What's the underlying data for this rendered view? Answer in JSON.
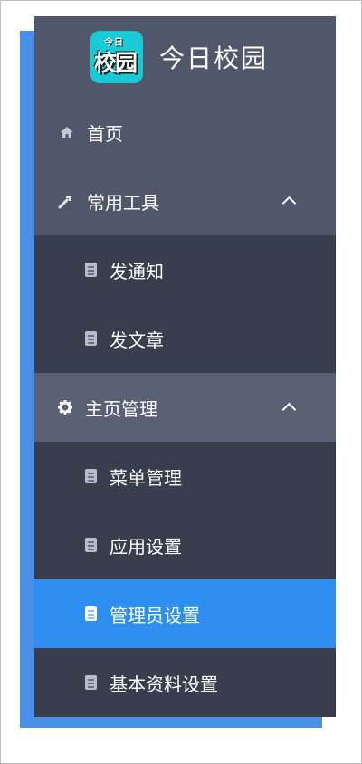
{
  "logo": {
    "badge_top": "今日",
    "badge_main": "校园",
    "title": "今日校园"
  },
  "nav": {
    "home": {
      "label": "首页",
      "icon": "home-icon"
    },
    "tools": {
      "label": "常用工具",
      "icon": "wrench-icon",
      "expanded": true,
      "items": [
        {
          "label": "发通知",
          "icon": "document-icon"
        },
        {
          "label": "发文章",
          "icon": "document-icon"
        }
      ]
    },
    "homepage_mgmt": {
      "label": "主页管理",
      "icon": "gear-icon",
      "expanded": true,
      "items": [
        {
          "label": "菜单管理",
          "icon": "document-icon"
        },
        {
          "label": "应用设置",
          "icon": "document-icon"
        },
        {
          "label": "管理员设置",
          "icon": "document-icon",
          "selected": true
        },
        {
          "label": "基本资料设置",
          "icon": "document-icon"
        }
      ]
    }
  },
  "colors": {
    "sidebar_bg": "#50576b",
    "submenu_bg": "#393e4f",
    "selected_bg": "#2e8ff0",
    "shadow_blue": "#4a8fe7",
    "logo_bg": "#18c9d6"
  }
}
